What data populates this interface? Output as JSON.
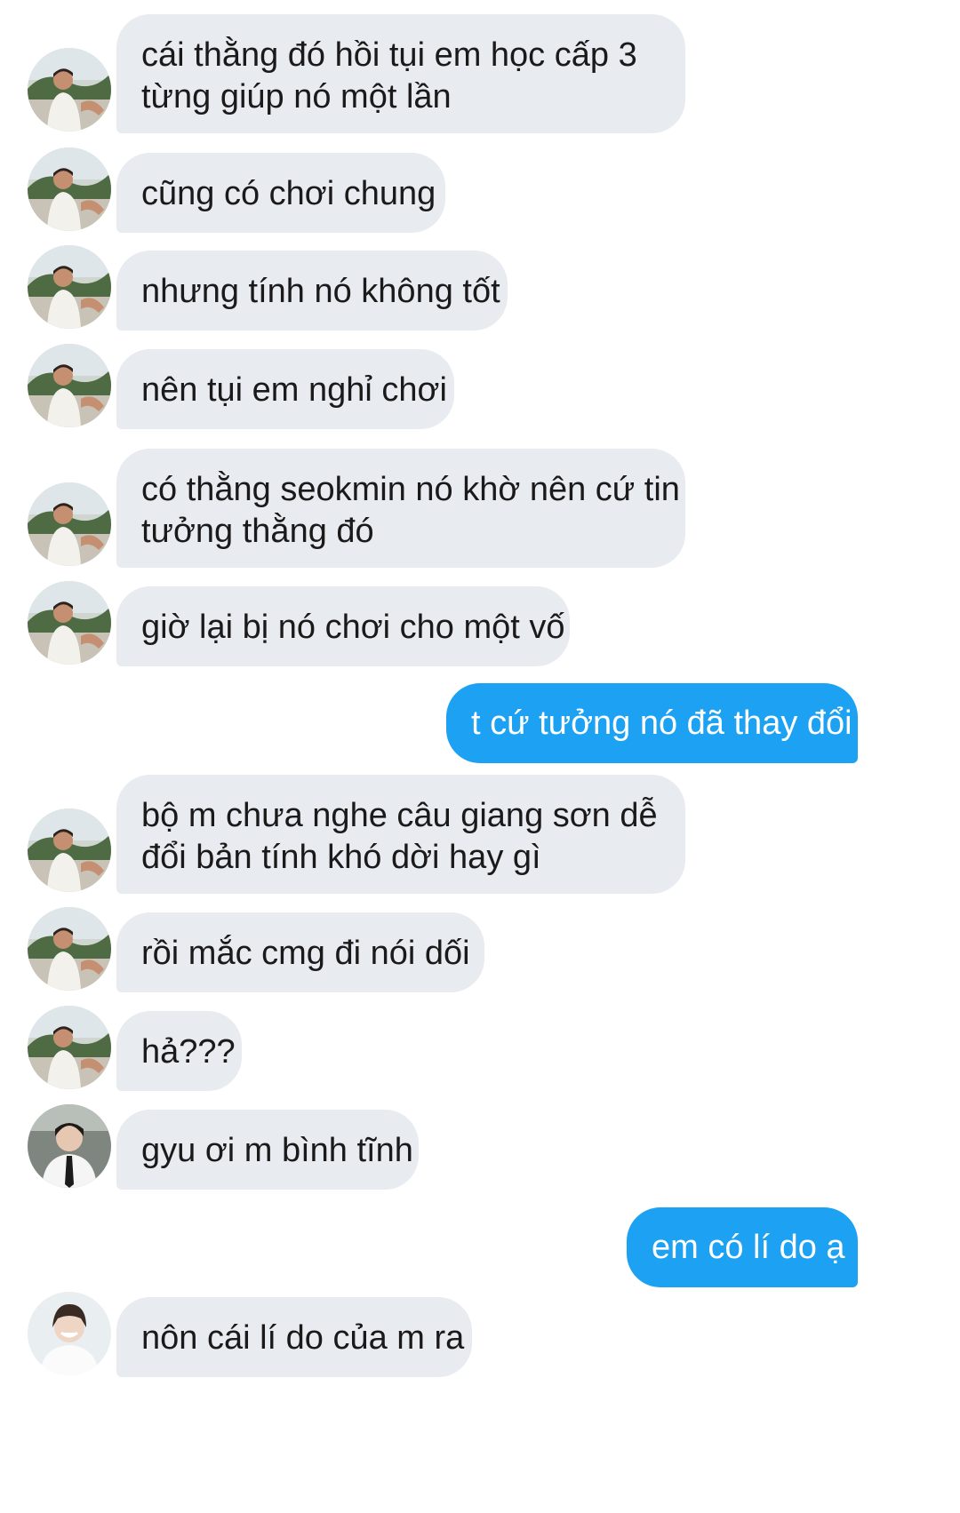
{
  "messages": [
    {
      "side": "recv",
      "avatar": "avatar-a",
      "lines": [
        "cái thằng đó hồi tụi em học cấp 3",
        "từng giúp nó một lần"
      ]
    },
    {
      "side": "recv",
      "avatar": "avatar-a",
      "lines": [
        "cũng có chơi chung"
      ]
    },
    {
      "side": "recv",
      "avatar": "avatar-a",
      "lines": [
        "nhưng tính nó không tốt"
      ]
    },
    {
      "side": "recv",
      "avatar": "avatar-a",
      "lines": [
        "nên tụi em nghỉ chơi"
      ]
    },
    {
      "side": "recv",
      "avatar": "avatar-a",
      "lines": [
        "có thằng seokmin nó khờ nên cứ tin",
        "tưởng thằng đó"
      ]
    },
    {
      "side": "recv",
      "avatar": "avatar-a",
      "lines": [
        "giờ lại bị nó chơi cho một vố"
      ]
    },
    {
      "side": "sent",
      "lines": [
        "t cứ tưởng nó đã thay đổi"
      ]
    },
    {
      "side": "recv",
      "avatar": "avatar-a",
      "lines": [
        "bộ m chưa nghe câu giang sơn dễ",
        "đổi bản tính khó dời hay gì"
      ]
    },
    {
      "side": "recv",
      "avatar": "avatar-a",
      "lines": [
        "rồi mắc cmg đi nói dối"
      ]
    },
    {
      "side": "recv",
      "avatar": "avatar-a",
      "lines": [
        "hả???"
      ]
    },
    {
      "side": "recv",
      "avatar": "avatar-b",
      "lines": [
        "gyu ơi m bình tĩnh"
      ]
    },
    {
      "side": "sent",
      "lines": [
        "em có lí do ạ"
      ]
    },
    {
      "side": "recv",
      "avatar": "avatar-c",
      "lines": [
        "nôn cái lí do của m ra"
      ]
    }
  ],
  "colors": {
    "received_bubble": "#e8ebef",
    "sent_bubble": "#1da1f2",
    "received_text": "#1a1a1a",
    "sent_text": "#ffffff"
  }
}
